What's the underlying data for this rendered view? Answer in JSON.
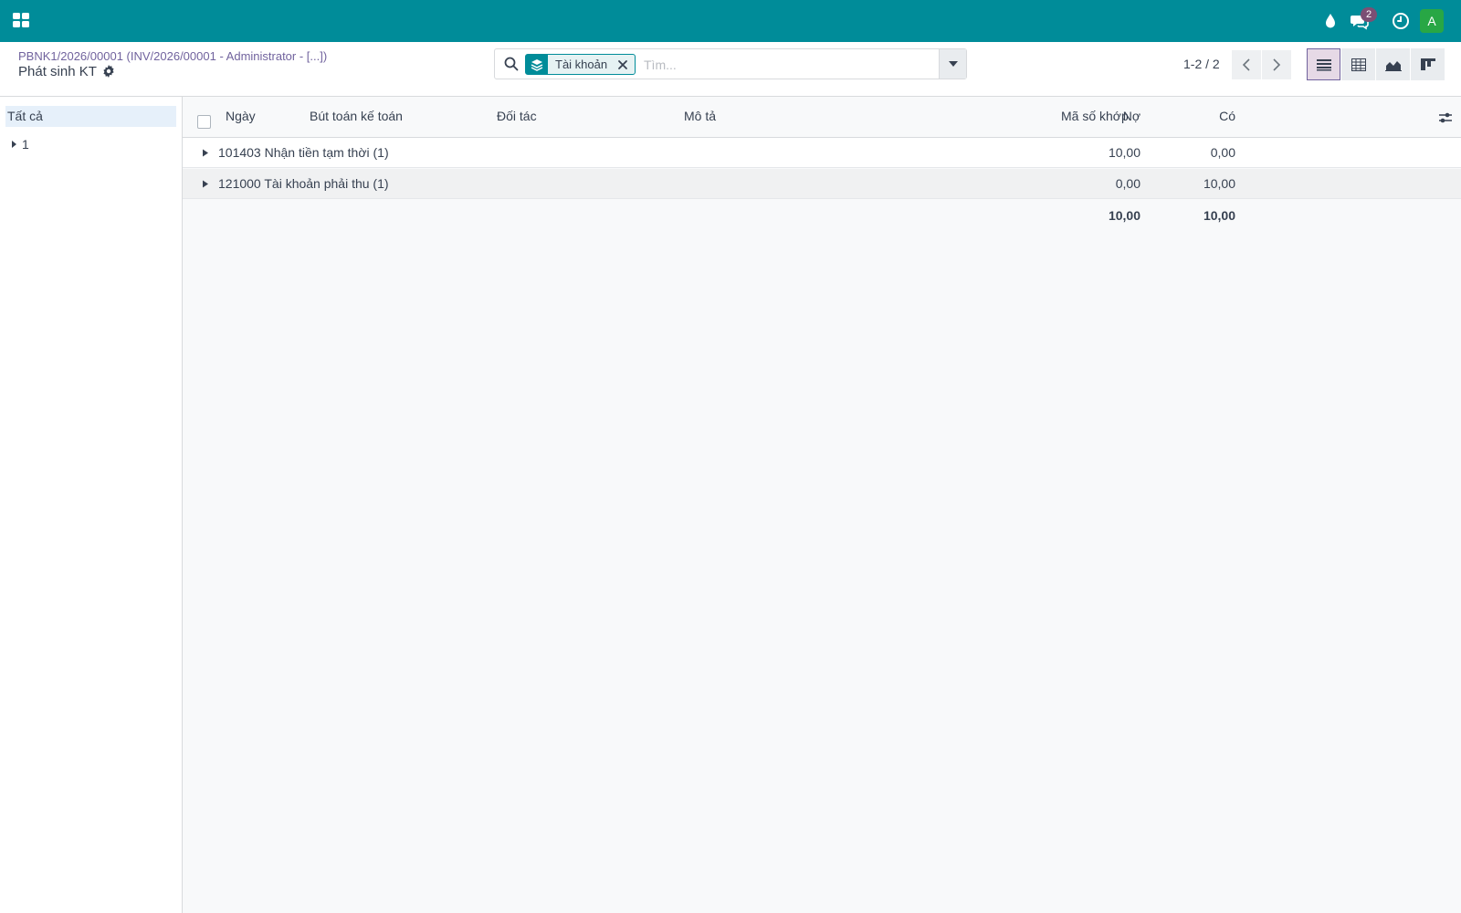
{
  "navbar": {
    "apps_icon": "apps-grid-icon",
    "icons": [
      "drop-icon",
      "chat-icon",
      "clock-icon"
    ],
    "messages_badge": "2",
    "avatar_letter": "A",
    "bg_color": "#008c99"
  },
  "control_panel": {
    "breadcrumb": "PBNK1/2026/00001 (INV/2026/00001 - Administrator - [...])",
    "title": "Phát sinh KT",
    "search": {
      "facet_label": "Tài khoản",
      "placeholder": "Tìm..."
    },
    "pager": {
      "value": "1-2 / 2"
    },
    "views": [
      "list",
      "pivot",
      "graph",
      "kanban"
    ],
    "active_view": "list"
  },
  "side_panel": {
    "items": [
      {
        "label": "Tất cả"
      },
      {
        "label": "1"
      }
    ]
  },
  "list": {
    "columns": {
      "date": "Ngày",
      "move": "Bút toán kế toán",
      "partner": "Đối tác",
      "name": "Mô tả",
      "debit": "Nợ",
      "credit": "Có",
      "matching": "Mã số khớp"
    },
    "groups": [
      {
        "name": "101403 Nhận tiền tạm thời (1)",
        "debit": "10,00",
        "credit": "0,00"
      },
      {
        "name": "121000 Tài khoản phải thu (1)",
        "debit": "0,00",
        "credit": "10,00"
      }
    ],
    "totals": {
      "debit": "10,00",
      "credit": "10,00"
    }
  }
}
